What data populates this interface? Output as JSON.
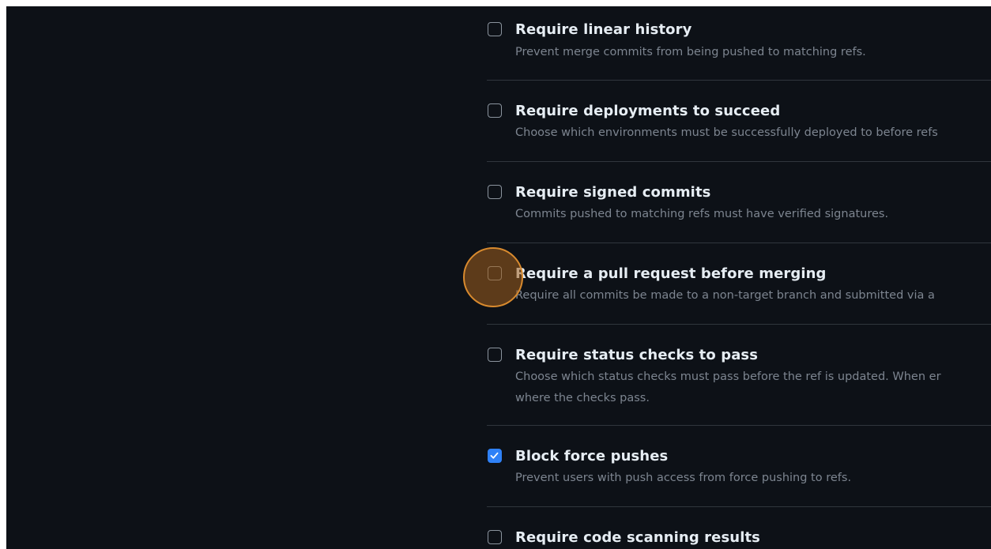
{
  "rules": [
    {
      "title": "Require linear history",
      "description_lines": [
        "Prevent merge commits from being pushed to matching refs."
      ],
      "checked": false
    },
    {
      "title": "Require deployments to succeed",
      "description_lines": [
        "Choose which environments must be successfully deployed to before refs"
      ],
      "checked": false
    },
    {
      "title": "Require signed commits",
      "description_lines": [
        "Commits pushed to matching refs must have verified signatures."
      ],
      "checked": false
    },
    {
      "title": "Require a pull request before merging",
      "description_lines": [
        "Require all commits be made to a non-target branch and submitted via a"
      ],
      "checked": false
    },
    {
      "title": "Require status checks to pass",
      "description_lines": [
        "Choose which status checks must pass before the ref is updated. When er",
        "where the checks pass."
      ],
      "checked": false
    },
    {
      "title": "Block force pushes",
      "description_lines": [
        "Prevent users with push access from force pushing to refs."
      ],
      "checked": true
    },
    {
      "title": "Require code scanning results",
      "description_lines": [],
      "checked": false
    }
  ],
  "colors": {
    "background": "#0d1117",
    "title": "#e6edf3",
    "description": "#7d8590",
    "divider": "#30363d",
    "checkbox_checked": "#2f81f7",
    "click_marker": "#d88a2e"
  },
  "icons": {
    "checkbox_check": "check-icon"
  }
}
